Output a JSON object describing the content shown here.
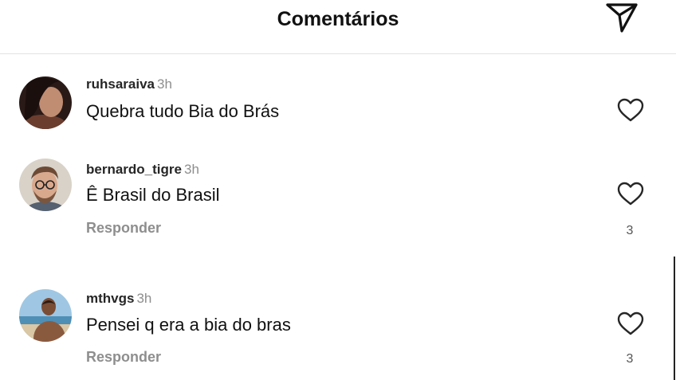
{
  "header": {
    "title": "Comentários"
  },
  "comments": [
    {
      "user": "ruhsaraiva",
      "time": "3h",
      "text": "Quebra tudo Bia do Brás"
    },
    {
      "user": "bernardo_tigre",
      "time": "3h",
      "text": "Ê Brasil do Brasil",
      "reply_label": "Responder",
      "likes": "3"
    },
    {
      "user": "mthvgs",
      "time": "3h",
      "text": "Pensei q era a bia do bras",
      "reply_label": "Responder",
      "likes": "3"
    }
  ],
  "icons": {
    "share": "paper-plane-icon",
    "like": "heart-outline-icon"
  },
  "colors": {
    "meta_gray": "#8e8e8e",
    "text": "#111111",
    "divider": "#e3e3e3"
  }
}
